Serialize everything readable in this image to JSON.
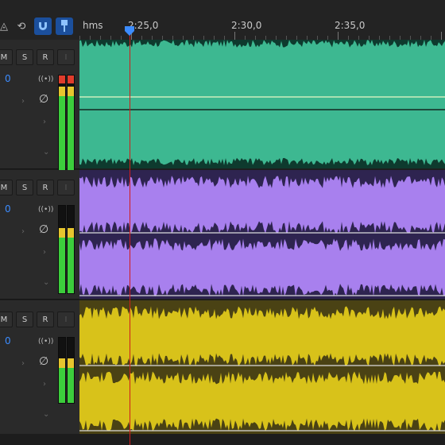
{
  "ruler": {
    "unit_label": "hms",
    "labels": [
      "2:25,0",
      "2:30,0",
      "2:35,0"
    ]
  },
  "toolbar": {
    "tools": [
      "triangle-tool-icon",
      "loop-icon",
      "snap-magnet-icon",
      "marker-pin-icon"
    ]
  },
  "tracks": [
    {
      "mute": "M",
      "solo": "S",
      "record": "R",
      "input": "I",
      "volume": "0",
      "color": "#3db891",
      "bg": "#0e3a2e",
      "stereo": false
    },
    {
      "mute": "M",
      "solo": "S",
      "record": "R",
      "input": "I",
      "volume": "0",
      "color": "#a880ee",
      "bg": "#2e2450",
      "stereo": true
    },
    {
      "mute": "M",
      "solo": "S",
      "record": "R",
      "input": "I",
      "volume": "0",
      "color": "#d8c21a",
      "bg": "#4a4214",
      "stereo": true
    }
  ],
  "playhead_time": "2:25,0"
}
